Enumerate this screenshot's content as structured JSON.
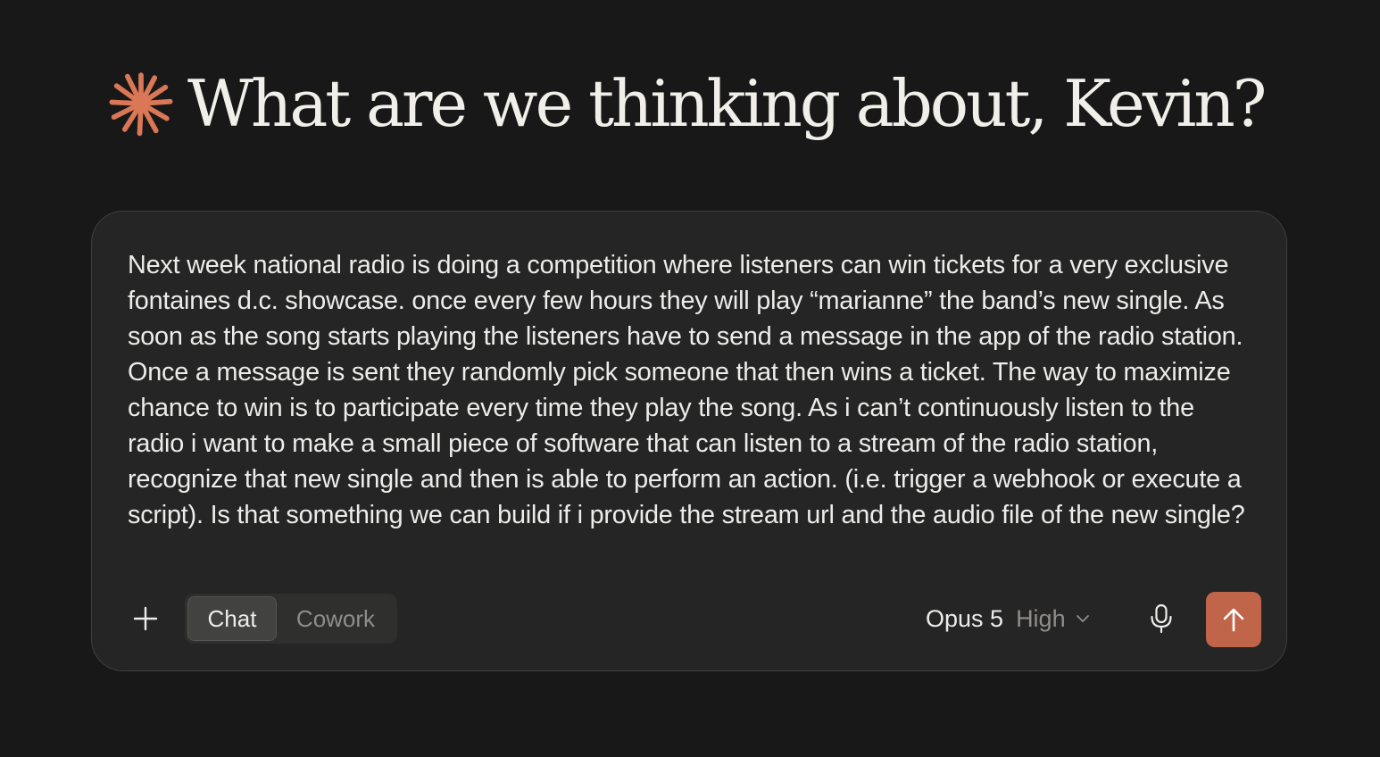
{
  "greeting": {
    "text": "What are we thinking about, Kevin?",
    "icon": "spark-icon",
    "icon_color": "#d97757"
  },
  "composer": {
    "prompt": "Next week national radio is doing a competition where listeners can win tickets for a very exclusive fontaines d.c. showcase. once every few hours they will play “marianne” the band’s new single. As soon as the song starts playing the listeners have to send a message in the app of the radio station. Once a message is sent they randomly pick someone that then wins a ticket. The way to maximize chance to win is to participate every time they play the song. As i can’t continuously listen to the radio i want to make a small piece of software that can listen to a stream of the radio station, recognize that new single and then is able to perform an action. (i.e. trigger a webhook or execute a script). Is that something we can build if i provide the stream url and the audio file of the new single?",
    "misspelled_words": [
      "fontaines",
      "marianne",
      "webhook"
    ]
  },
  "toolbar": {
    "add_icon": "plus-icon",
    "modes": [
      {
        "label": "Chat",
        "active": true
      },
      {
        "label": "Cowork",
        "active": false
      }
    ],
    "model": {
      "name": "Opus 5",
      "effort": "High",
      "icon": "chevron-down-icon"
    },
    "mic_icon": "microphone-icon",
    "send_icon": "arrow-up-icon",
    "send_color": "#c1654a"
  }
}
